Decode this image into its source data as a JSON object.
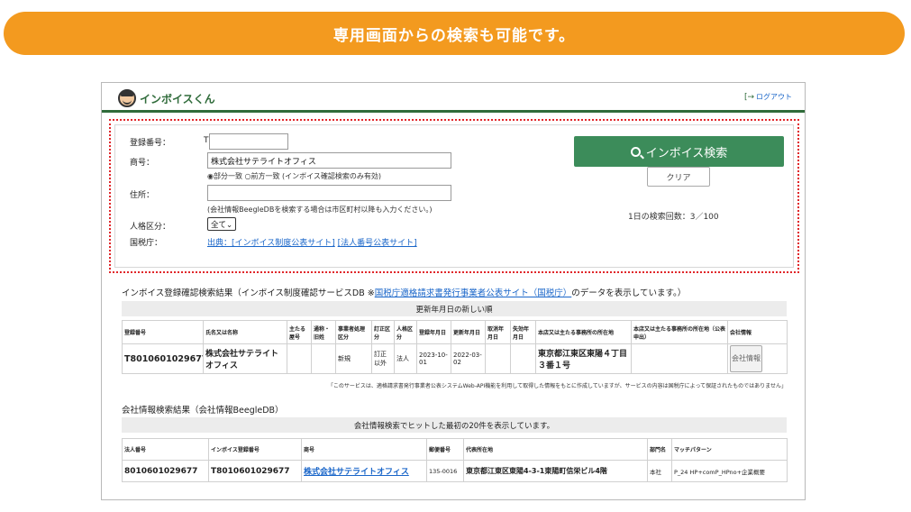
{
  "banner": {
    "text": "専用画面からの検索も可能です。"
  },
  "app": {
    "logo_text": "インボイスくん",
    "logout_label": "ログアウト"
  },
  "search": {
    "reg_label": "登録番号：",
    "reg_prefix": "T",
    "reg_value": "",
    "name_label": "商号：",
    "name_value": "株式会社サテライトオフィス",
    "match_options": "◉部分一致 ○前方一致 (インボイス確認検索のみ有効)",
    "address_label": "住所：",
    "address_value": "",
    "address_note": "(会社情報BeegleDBを検索する場合は市区町村以降も入力ください。)",
    "type_label": "人格区分：",
    "type_value": "全て",
    "source_label": "国税庁：",
    "source_link1": "出典：[インボイス制度公表サイト]",
    "source_link2": "[法人番号公表サイト]",
    "search_button": "インボイス検索",
    "clear_button": "クリア",
    "count_text": "1日の検索回数：3／100"
  },
  "results": {
    "title_prefix": "インボイス登録確認検索結果（インボイス制度確認サービスDB ※",
    "title_link": "国税庁適格請求書発行事業者公表サイト（国税庁）",
    "title_suffix": "のデータを表示しています。）",
    "sort_label": "更新年月日の新しい順",
    "headers": [
      "登録番号",
      "氏名又は名称",
      "主たる屋号",
      "通称・旧姓",
      "事業者処理区分",
      "訂正区分",
      "人格区分",
      "登録年月日",
      "更新年月日",
      "取消年月日",
      "失効年月日",
      "本店又は主たる事務所の所在地",
      "本店又は主たる事務所の所在地（公表申出）",
      "会社情報"
    ],
    "rows": [
      {
        "reg_no": "T8010601029677",
        "name": "株式会社サテライトオフィス",
        "trade_name": "",
        "alias": "",
        "process": "新規",
        "correction": "訂正以外",
        "type": "法人",
        "registered": "2023-10-01",
        "updated": "2022-03-02",
        "cancelled": "",
        "expired": "",
        "address": "東京都江東区東陽４丁目３番１号",
        "address_public": "",
        "company_button": "会社情報"
      }
    ],
    "disclaimer": "「このサービスは、適格請求書発行事業者公表システムWeb-API機能を利用して取得した情報をもとに作成していますが、サービスの内容は国税庁によって保証されたものではありません」"
  },
  "company": {
    "title": "会社情報検索結果（会社情報BeegleDB）",
    "info": "会社情報検索でヒットした最初の20件を表示しています。",
    "headers": [
      "法人番号",
      "インボイス登録番号",
      "商号",
      "郵便番号",
      "代表所在地",
      "部門名",
      "マッチパターン"
    ],
    "rows": [
      {
        "corp_no": "8010601029677",
        "invoice_no": "T8010601029677",
        "name": "株式会社サテライトオフィス",
        "zip": "135-0016",
        "address": "東京都江東区東陽4-3-1東陽町信栄ビル4階",
        "dept": "本社",
        "match": "P_24 HP+comP_HPno+企業概要"
      }
    ]
  },
  "colors": {
    "banner": "#f39a1f",
    "primary_green": "#3c8c5a",
    "highlight_border": "#e0262a",
    "link": "#1a66c9"
  }
}
